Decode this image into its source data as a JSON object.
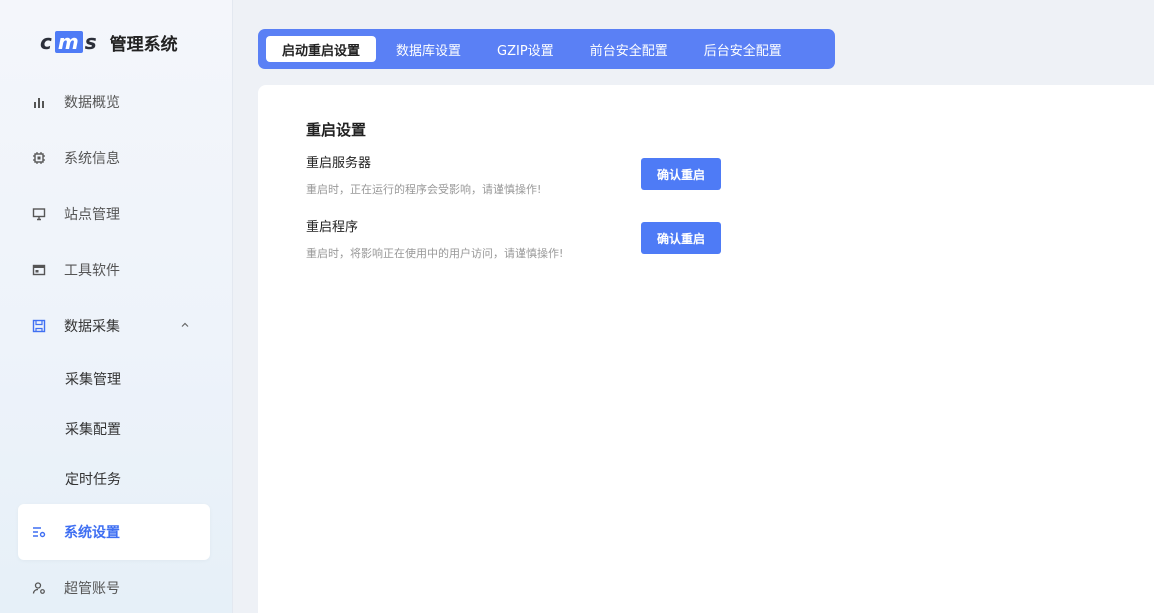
{
  "app": {
    "logo_text": "cms",
    "title": "管理系统"
  },
  "sidebar": {
    "items": [
      {
        "label": "数据概览",
        "icon": "bar-chart-icon"
      },
      {
        "label": "系统信息",
        "icon": "chip-icon"
      },
      {
        "label": "站点管理",
        "icon": "monitor-icon"
      },
      {
        "label": "工具软件",
        "icon": "window-icon"
      },
      {
        "label": "数据采集",
        "icon": "save-icon",
        "expanded": true,
        "children": [
          "采集管理",
          "采集配置",
          "定时任务"
        ]
      },
      {
        "label": "系统设置",
        "icon": "settings-list-icon",
        "active": true
      },
      {
        "label": "超管账号",
        "icon": "user-gear-icon"
      }
    ]
  },
  "tabs": [
    {
      "label": "启动重启设置",
      "active": true
    },
    {
      "label": "数据库设置"
    },
    {
      "label": "GZIP设置"
    },
    {
      "label": "前台安全配置"
    },
    {
      "label": "后台安全配置"
    }
  ],
  "main": {
    "section_title": "重启设置",
    "settings": [
      {
        "name": "重启服务器",
        "desc": "重启时，正在运行的程序会受影响，请谨慎操作!",
        "button": "确认重启"
      },
      {
        "name": "重启程序",
        "desc": "重启时，将影响正在使用中的用户访问，请谨慎操作!",
        "button": "确认重启"
      }
    ]
  },
  "colors": {
    "accent": "#4e7bf6",
    "tab_bar": "#5a80f5",
    "active_text": "#3f6ff2"
  }
}
